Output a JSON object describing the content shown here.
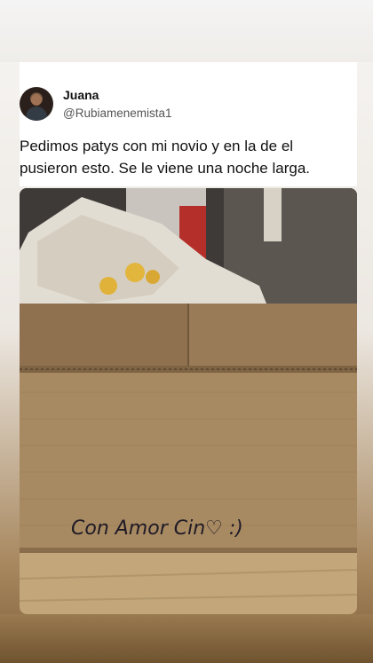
{
  "tweet": {
    "author_name": "Juana",
    "author_handle": "@Rubiamenemista1",
    "text": "Pedimos patys con mi novio y en la de el pusieron esto. Se le viene una noche larga."
  },
  "photo": {
    "handwriting": "Con Amor Cin♡ :)"
  }
}
